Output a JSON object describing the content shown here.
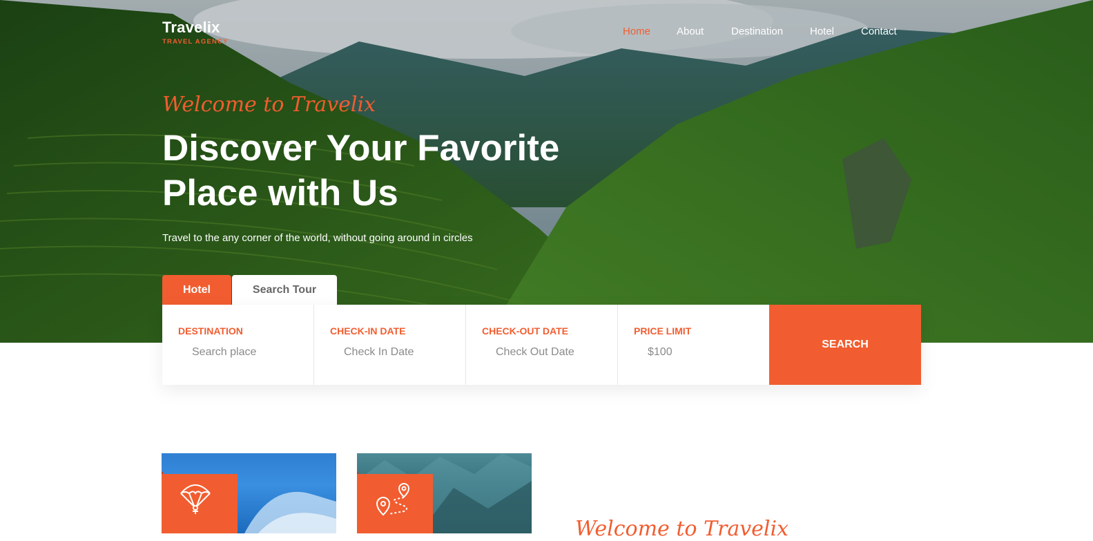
{
  "brand": {
    "name": "Travelix",
    "tagline": "TRAVEL AGENCY",
    "accent_color": "#f15d30"
  },
  "nav": {
    "items": [
      {
        "label": "Home",
        "active": true
      },
      {
        "label": "About",
        "active": false
      },
      {
        "label": "Destination",
        "active": false
      },
      {
        "label": "Hotel",
        "active": false
      },
      {
        "label": "Contact",
        "active": false
      }
    ]
  },
  "hero": {
    "welcome": "Welcome to Travelix",
    "headline_line1": "Discover Your Favorite",
    "headline_line2": "Place with Us",
    "subline": "Travel to the any corner of the world, without going around in circles"
  },
  "search": {
    "tabs": [
      {
        "label": "Hotel",
        "active": true
      },
      {
        "label": "Search Tour",
        "active": false
      }
    ],
    "fields": [
      {
        "label": "DESTINATION",
        "placeholder": "Search place"
      },
      {
        "label": "CHECK-IN DATE",
        "placeholder": "Check In Date"
      },
      {
        "label": "CHECK-OUT DATE",
        "placeholder": "Check Out Date"
      },
      {
        "label": "PRICE LIMIT",
        "placeholder": "$100"
      }
    ],
    "button_label": "SEARCH"
  },
  "features": {
    "cards": [
      {
        "icon": "parachute-icon"
      },
      {
        "icon": "route-icon"
      }
    ]
  },
  "about": {
    "welcome": "Welcome to Travelix"
  }
}
